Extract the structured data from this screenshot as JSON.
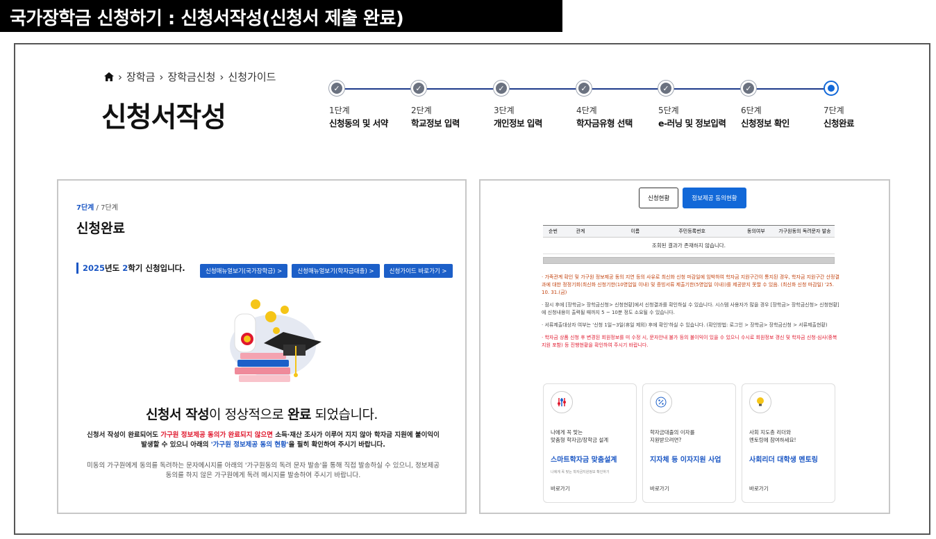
{
  "header": {
    "title": "국가장학금 신청하기 : 신청서작성(신청서 제출 완료)"
  },
  "breadcrumb": {
    "items": [
      "장학금",
      "장학금신청",
      "신청가이드"
    ]
  },
  "page_title": "신청서작성",
  "stepper": {
    "steps": [
      {
        "num": "1단계",
        "name": "신청동의 및 서약"
      },
      {
        "num": "2단계",
        "name": "학교정보 입력"
      },
      {
        "num": "3단계",
        "name": "개인정보 입력"
      },
      {
        "num": "4단계",
        "name": "학자금유형 선택"
      },
      {
        "num": "5단계",
        "name": "e-러닝 및 정보입력"
      },
      {
        "num": "6단계",
        "name": "신청정보 확인"
      },
      {
        "num": "7단계",
        "name": "신청완료"
      }
    ]
  },
  "left_panel": {
    "step_current": "7단계",
    "step_total": " / 7단계",
    "title": "신청완료",
    "notice_year": "2025",
    "notice_mid": "년도 ",
    "notice_term": "2",
    "notice_end": "학기 신청입니다.",
    "buttons": [
      "신청매뉴얼보기(국가장학금)  >",
      "신청매뉴얼보기(학자금대출)  >",
      "신청가이드 바로가기  >"
    ],
    "complete_a": "신청서 작성",
    "complete_b": "이 정상적으로 ",
    "complete_c": "완료",
    "complete_d": " 되었습니다.",
    "desc1_a": "신청서 작성이 완료되어도 ",
    "desc1_red": "가구원 정보제공 동의가 완료되지 않으면",
    "desc1_b": " 소득·재산 조사가 이루어 지지 않아 학자금 지원에 불이익이 발생할 수 있으니 아래의 ",
    "desc1_blue": "'가구원 정보제공 동의 현황'",
    "desc1_c": "을 필히 확인하여 주시기 바랍니다.",
    "desc2": "미동의 가구원에게 동의를 독려하는 문자메시지를 아래의 '가구원동의 독려 문자 발송'을 통해 직접 발송하실 수 있으니, 정보제공 동의를 하지 않은 가구원에게 독려 메시지를 발송하여 주시기 바랍니다."
  },
  "right_panel": {
    "tabs": [
      "신청현황",
      "정보제공 동의현황"
    ],
    "table_headers": [
      "순번",
      "관계",
      "이름",
      "주민등록번호",
      "동의여부",
      "가구원동의 독려문자 발송"
    ],
    "empty_text": "조회된 결과가 존재하지 않습니다.",
    "notes": {
      "n1": "· 가족관계 확인 및 가구원 정보제공 동의 지연 등의 사유로 최신화 신청 마감일에 임박하여 학자금 지원구간이 통지된 경우, 학자금 지원구간 산정결과에 대한 정정기회(최신화 신청기한(10영업일 이내) 및 증빙서류 제출기한(5영업일 이내))를 제공받지 못할 수 있음. (최신화 신청 마감일) '25. 10. 31.(금)",
      "n2": "· 잠시 후에 [장학금> 장학금신청> 신청현황]에서 신청결과를 확인하실 수 있습니다. 시스템 사용자가 많을 경우 [장학금> 장학금신청> 신청현황]에 신청내용이 출력될 때까지 5 ~ 10분 정도 소요될 수 있습니다.",
      "n3": "· 서류제출대상자 여부는 '신청 1일~3일(휴일 제외) 후에 확인'하실 수 있습니다. (확인방법: 로그인 > 장학금> 장학금신청 > 서류제출현황)",
      "n4": "· 학자금 상품 신청 후 변경된 회원정보를 미 수정 시, 문자안내 불가 등의 불이익이 있을 수 있으니 수시로 회원정보 갱신 및 학자금 신청·심사(중복지원 포함) 등 진행현황을 확인하여 주시기 바랍니다."
    },
    "cards": [
      {
        "icon": "sliders-icon",
        "sub": "나에게 꼭 맞는\n맞춤형 학자금/장학금 설계",
        "title": "스마트학자금 맞춤설계",
        "tiny": "나에게 꼭 맞는 학자금지원정보 확인하기",
        "go": "바로가기"
      },
      {
        "icon": "percent-icon",
        "sub": "학자금대출의 이자를\n지원받으려면?",
        "title": "지자체 등 이자지원 사업",
        "tiny": "",
        "go": "바로가기"
      },
      {
        "icon": "lightbulb-icon",
        "sub": "사회 지도층 리더와\n멘토링에 참여하세요!",
        "title": "사회리더 대학생 멘토링",
        "tiny": "",
        "go": "바로가기"
      }
    ]
  }
}
